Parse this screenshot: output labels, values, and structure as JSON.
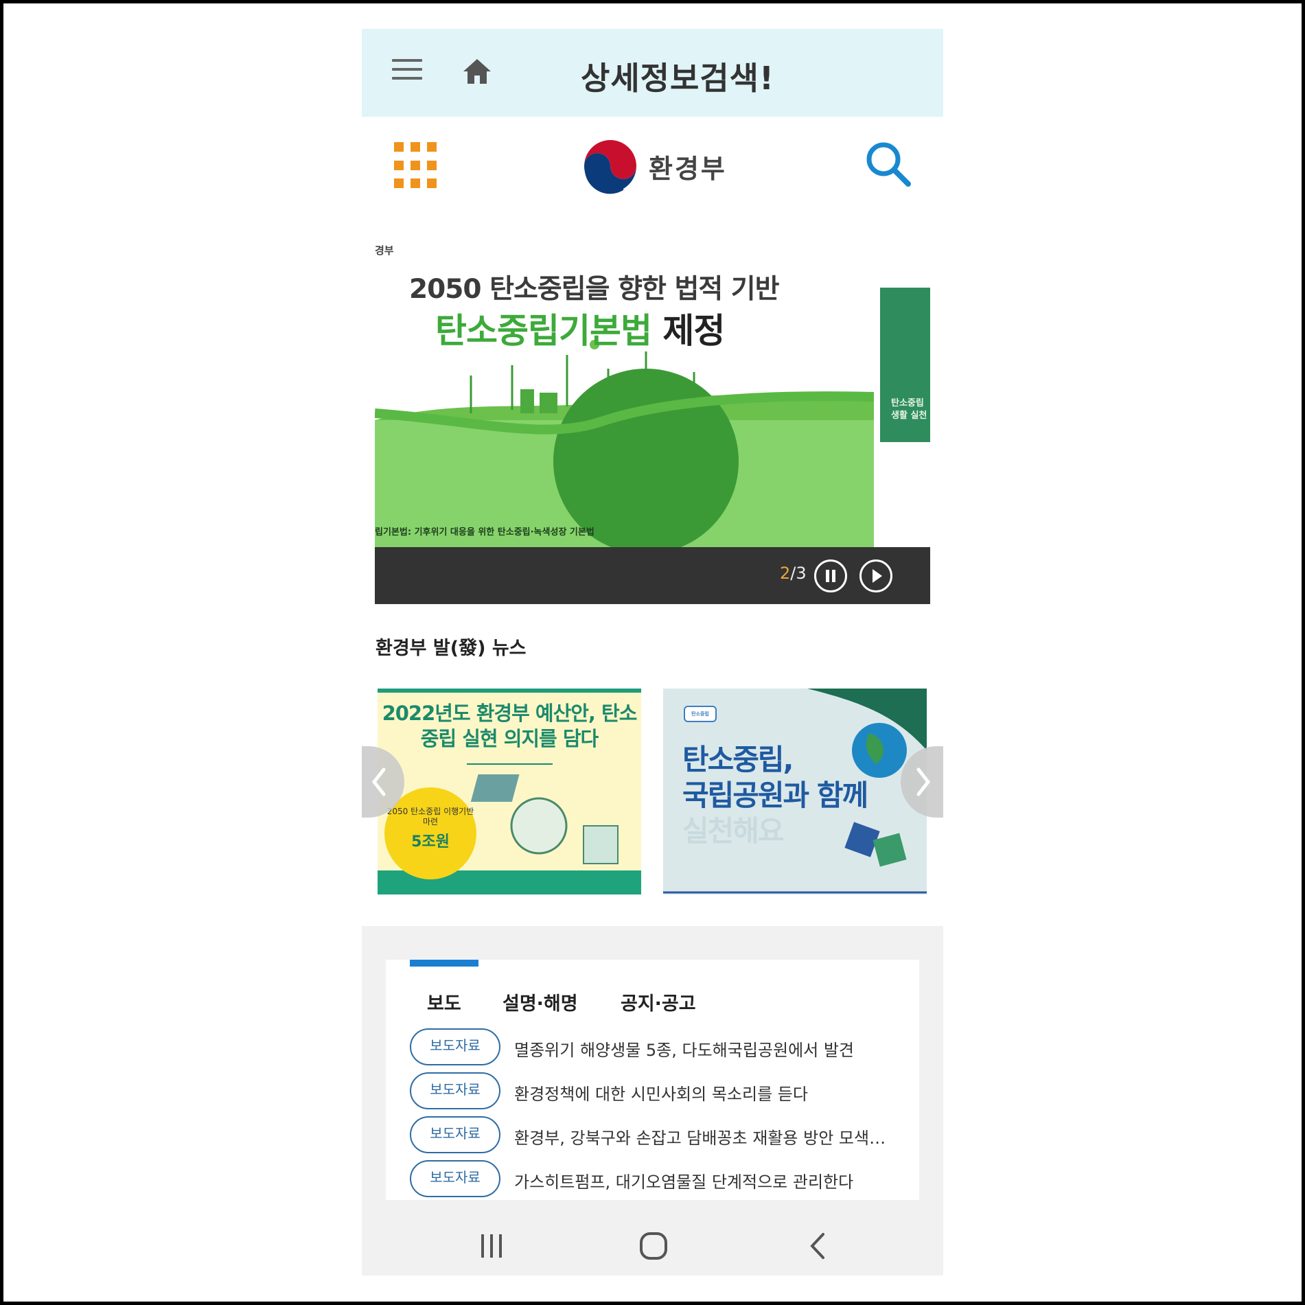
{
  "appbar": {
    "title": "상세정보검색!",
    "menu_icon": "hamburger-icon",
    "home_icon": "home-icon"
  },
  "header": {
    "logo_text": "환경부",
    "menu_icon": "grid-menu-icon",
    "search_icon": "search-icon"
  },
  "banner": {
    "tag": "경부",
    "line1": "2050 탄소중립을 향한 법적 기반",
    "line2_highlight": "탄소중립기본법",
    "line2_rest": " 제정",
    "caption": "립기본법: 기후위기 대응을 위한 탄소중립·녹색성장 기본법",
    "next_preview_text": "탄소중립 생활 실천",
    "page_current": "2",
    "page_total": "/3",
    "pause_icon": "pause-icon",
    "play_icon": "play-icon"
  },
  "news": {
    "title": "환경부 발(發) 뉴스",
    "card1": {
      "title": "2022년도 환경부 예산안, 탄소중립 실현 의지를 담다",
      "badge_sub": "2050 탄소중립 이행기반 마련",
      "badge_value": "5조원"
    },
    "card2": {
      "logo": "탄소중립",
      "title_line1": "탄소중립,",
      "title_line2": "국립공원과 함께",
      "title_line3": "실천해요"
    },
    "prev_icon": "chevron-left-icon",
    "next_icon": "chevron-right-icon"
  },
  "notices": {
    "tabs": [
      "보도",
      "설명·해명",
      "공지·공고"
    ],
    "items": [
      {
        "badge": "보도자료",
        "text": "멸종위기 해양생물 5종, 다도해국립공원에서 발견"
      },
      {
        "badge": "보도자료",
        "text": "환경정책에 대한 시민사회의 목소리를 듣다"
      },
      {
        "badge": "보도자료",
        "text": "환경부, 강북구와 손잡고 담배꽁초 재활용 방안 모색…"
      },
      {
        "badge": "보도자료",
        "text": "가스히트펌프, 대기오염물질 단계적으로 관리한다"
      }
    ]
  },
  "navbar": {
    "recent_icon": "recent-apps-icon",
    "home_icon": "home-circle-icon",
    "back_icon": "back-icon"
  },
  "colors": {
    "appbar_bg": "#e1f4f7",
    "accent_orange": "#f0931c",
    "accent_blue": "#1a7fd1",
    "banner_green": "#3daa3a",
    "bar_dark": "#333333"
  }
}
